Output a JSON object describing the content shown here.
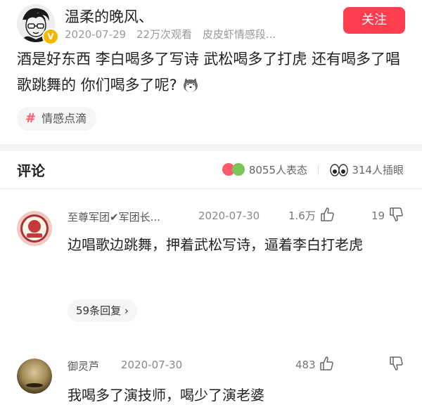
{
  "post": {
    "author": "温柔的晚风、",
    "date": "2020-07-29",
    "views": "22万次观看",
    "source": "皮皮虾情感段...",
    "follow_label": "关注",
    "text": "酒是好东西 李白喝多了写诗 武松喝多了打虎 还有喝多了唱歌跳舞的 你们喝多了呢?",
    "tag_symbol": "#",
    "tag": "情感点滴"
  },
  "comments_header": {
    "title": "评论",
    "reactions_count": "8055人表态",
    "eye_count": "314人插眼"
  },
  "comments": [
    {
      "name": "至尊军团✔军团长...",
      "date": "2020-07-30",
      "likes": "1.6万",
      "dislikes": "19",
      "text": "边唱歌边跳舞，押着武松写诗，逼着李白打老虎",
      "replies_label": "59条回复",
      "reply_chevron": "›"
    },
    {
      "name": "御灵芦",
      "date": "2020-07-30",
      "likes": "483",
      "dislikes": "",
      "text": "我喝多了演技师，喝少了演老婆"
    }
  ],
  "colors": {
    "accent": "#ff3e4f",
    "badge": "#f5b800"
  }
}
